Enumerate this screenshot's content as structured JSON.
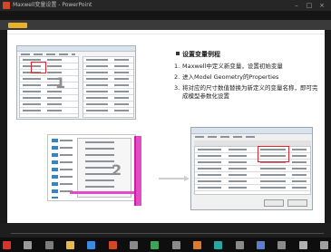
{
  "window": {
    "title": "Maxwell变量设置 - PowerPoint",
    "minimize": "–",
    "maximize": "□",
    "close": "×"
  },
  "slide": {
    "title": "设置变量例程",
    "steps": [
      {
        "num": "1.",
        "text": "Maxwell中定义新变量，设置初始变量"
      },
      {
        "num": "2.",
        "text": "进入Model Geometry的Properties"
      },
      {
        "num": "3.",
        "text": "将对应的尺寸数值替换为新定义的变量名称，即可完成模型参数化设置"
      }
    ],
    "callout_1": "1",
    "callout_2": "2"
  },
  "colors": {
    "app_icon": "#d24726",
    "tab_marker": "#e8b12a",
    "highlight_red": "#e1262d",
    "highlight_magenta": "#e44bc8"
  },
  "taskbar": {
    "icons": [
      {
        "name": "start-icon",
        "color": "#d9342b"
      },
      {
        "name": "search-icon",
        "color": "#9a9a9a"
      },
      {
        "name": "task-view-icon",
        "color": "#7d7d7d"
      },
      {
        "name": "file-explorer-icon",
        "color": "#e8b84a"
      },
      {
        "name": "browser-icon",
        "color": "#3b8be0"
      },
      {
        "name": "powerpoint-icon",
        "color": "#d24726"
      },
      {
        "name": "app-icon-7",
        "color": "#8a8a8a"
      },
      {
        "name": "app-icon-8",
        "color": "#3fa35c"
      },
      {
        "name": "app-icon-9",
        "color": "#8a8a8a"
      },
      {
        "name": "app-icon-10",
        "color": "#e07a2a"
      },
      {
        "name": "app-icon-11",
        "color": "#2aa6a0"
      },
      {
        "name": "app-icon-12",
        "color": "#8a8a8a"
      },
      {
        "name": "app-icon-13",
        "color": "#5a7fd0"
      },
      {
        "name": "app-icon-14",
        "color": "#8a8a8a"
      },
      {
        "name": "app-icon-15",
        "color": "#b0b0b0"
      },
      {
        "name": "notification-icon",
        "color": "#a0a0a0"
      }
    ]
  }
}
